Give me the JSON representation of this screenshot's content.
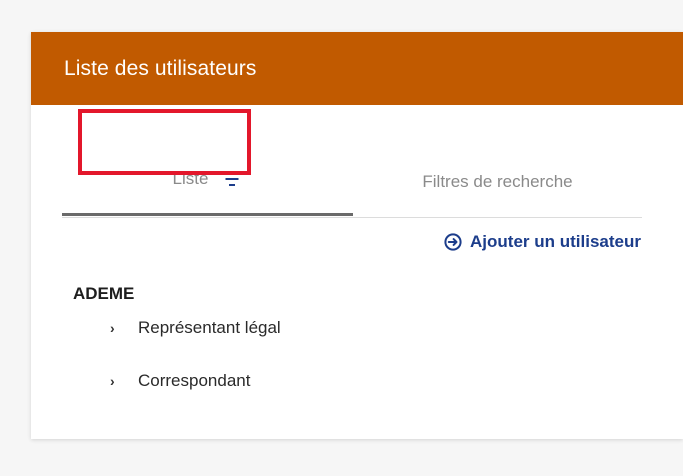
{
  "card": {
    "title": "Liste des utilisateurs",
    "header_color": "#c15a00"
  },
  "tabs": [
    {
      "label": "Liste",
      "icon": "filter-icon",
      "active": true
    },
    {
      "label": "Filtres de recherche",
      "active": false
    }
  ],
  "actions": {
    "add_user": {
      "label": "Ajouter un utilisateur",
      "icon": "circle-arrow-right-icon",
      "color": "#1c3d8b"
    }
  },
  "organization": {
    "name": "ADEME",
    "items": [
      {
        "label": "Représentant légal",
        "icon": "chevron-right-icon"
      },
      {
        "label": "Correspondant",
        "icon": "chevron-right-icon"
      }
    ]
  },
  "highlight": {
    "color": "#e3172b"
  }
}
